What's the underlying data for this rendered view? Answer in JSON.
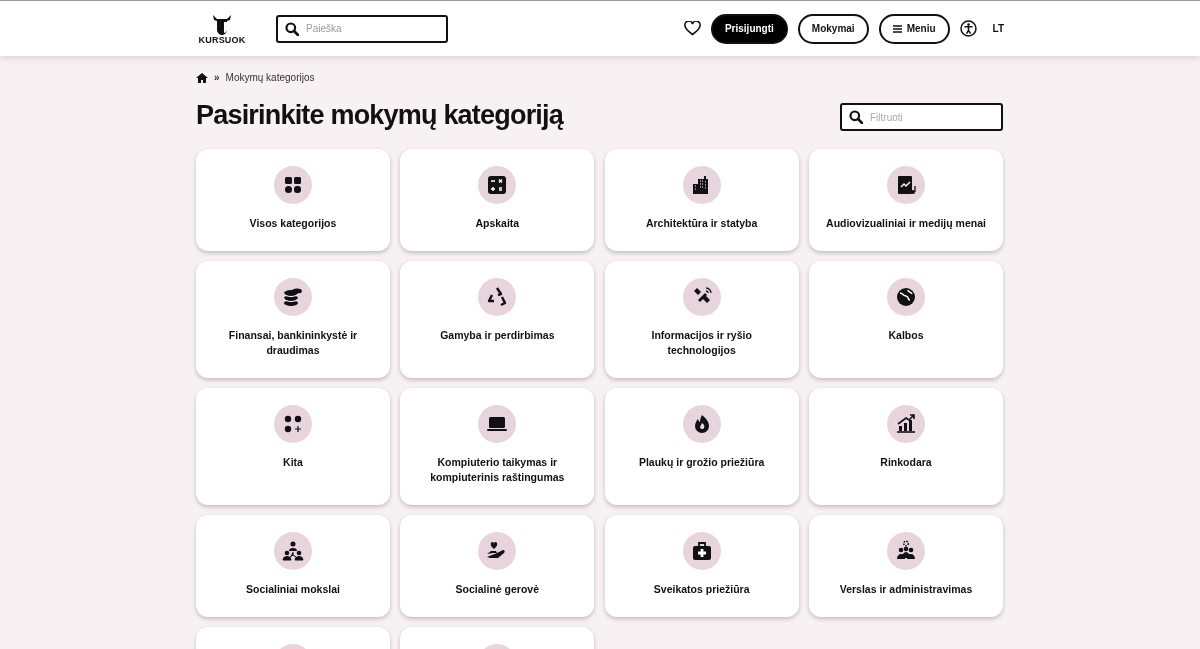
{
  "header": {
    "logo_text": "KURSUOK",
    "search": {
      "placeholder": "Paieška"
    },
    "login_button": "Prisijungti",
    "courses_button": "Mokymai",
    "menu_button": "Meniu",
    "language": "LT"
  },
  "breadcrumb": {
    "separator": "»",
    "current": "Mokymų kategorijos"
  },
  "title": "Pasirinkite mokymų kategoriją",
  "filter": {
    "placeholder": "Filtruoti"
  },
  "categories": [
    {
      "kind": "category",
      "label": "Visos kategorijos"
    },
    {
      "kind": "category",
      "label": "Apskaita"
    },
    {
      "kind": "category",
      "label": "Architektūra ir statyba"
    },
    {
      "kind": "category",
      "label": "Audiovizualiniai ir medijų menai"
    },
    {
      "kind": "category",
      "label": "Finansai, bankininkystė ir draudimas"
    },
    {
      "kind": "category",
      "label": "Gamyba ir perdirbimas"
    },
    {
      "kind": "category",
      "label": "Informacijos ir ryšio technologijos"
    },
    {
      "kind": "category",
      "label": "Kalbos"
    },
    {
      "kind": "category",
      "label": "Kita"
    },
    {
      "kind": "category",
      "label": "Kompiuterio taikymas ir kompiuterinis raštingumas"
    },
    {
      "kind": "category",
      "label": "Plaukų ir grožio priežiūra"
    },
    {
      "kind": "category",
      "label": "Rinkodara"
    },
    {
      "kind": "category",
      "label": "Socialiniai mokslai"
    },
    {
      "kind": "category",
      "label": "Socialinė gerovė"
    },
    {
      "kind": "category",
      "label": "Sveikatos priežiūra"
    },
    {
      "kind": "category",
      "label": "Verslas ir administravimas"
    },
    {
      "kind": "cut_off"
    },
    {
      "kind": "cut_off"
    }
  ]
}
